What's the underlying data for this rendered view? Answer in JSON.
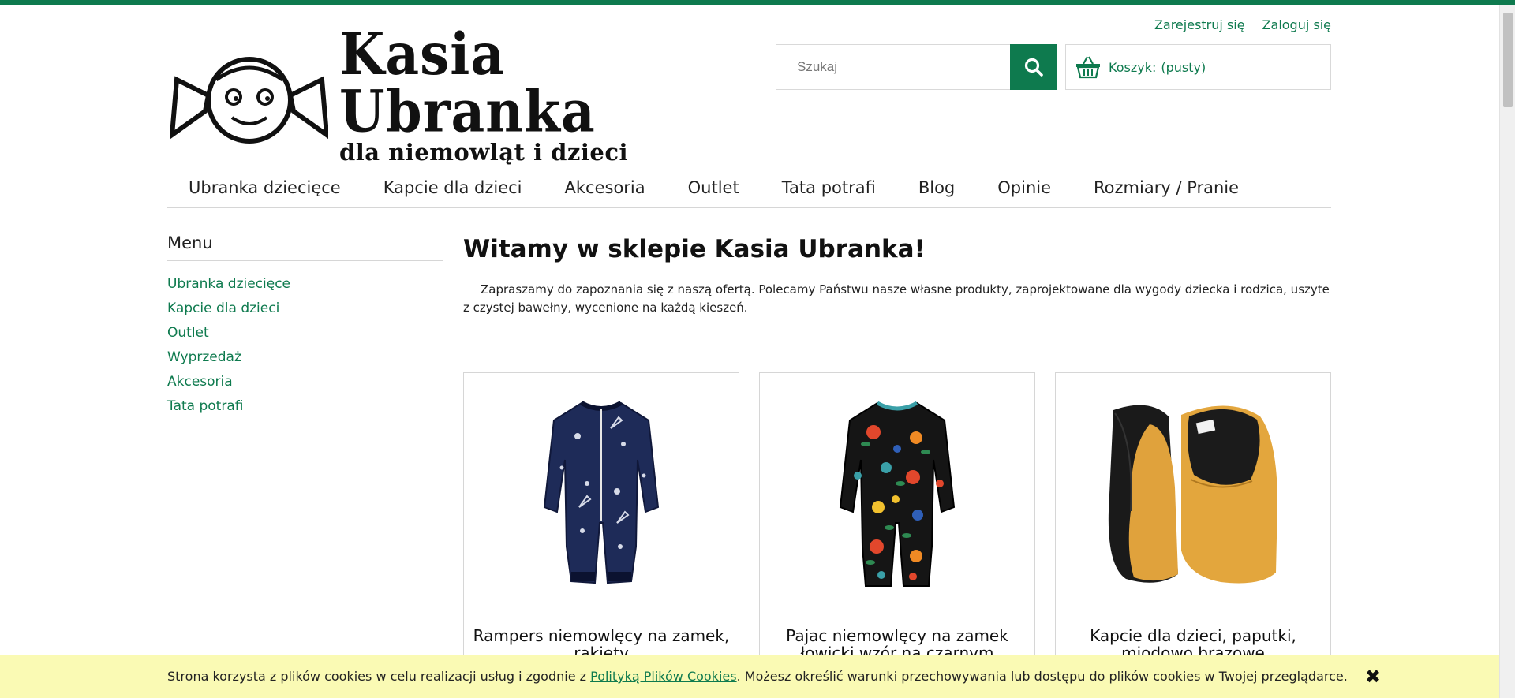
{
  "account": {
    "register": "Zarejestruj się",
    "login": "Zaloguj się"
  },
  "logo": {
    "title": "Kasia Ubranka",
    "subtitle": "dla niemowląt i dzieci"
  },
  "search": {
    "placeholder": "Szukaj"
  },
  "cart": {
    "label": "Koszyk:",
    "status": "(pusty)"
  },
  "nav": [
    "Ubranka dziecięce",
    "Kapcie dla dzieci",
    "Akcesoria",
    "Outlet",
    "Tata potrafi",
    "Blog",
    "Opinie",
    "Rozmiary / Pranie"
  ],
  "sidebar": {
    "title": "Menu",
    "items": [
      "Ubranka dziecięce",
      "Kapcie dla dzieci",
      "Outlet",
      "Wyprzedaż",
      "Akcesoria",
      "Tata potrafi"
    ]
  },
  "content": {
    "heading": "Witamy w sklepie Kasia Ubranka!",
    "intro": "Zapraszamy do zapoznania się z naszą ofertą. Polecamy Państwu nasze własne produkty, zaprojektowane dla wygody dziecka i rodzica, uszyte z czystej bawełny, wycenione na każdą kieszeń."
  },
  "products": [
    {
      "name": "Rampers niemowlęcy na zamek, rakiety"
    },
    {
      "name": "Pajac niemowlęcy na zamek łowicki wzór na czarnym"
    },
    {
      "name": "Kapcie dla dzieci, paputki, miodowo brazowe"
    }
  ],
  "cookie": {
    "text_before": "Strona korzysta z plików cookies w celu realizacji usług i zgodnie z ",
    "link": "Polityką Plików Cookies",
    "text_after": ". Możesz określić warunki przechowywania lub dostępu do plików cookies w Twojej przeglądarce."
  },
  "colors": {
    "brand": "#0e7a4e",
    "cookie_bg": "#fafab4"
  }
}
